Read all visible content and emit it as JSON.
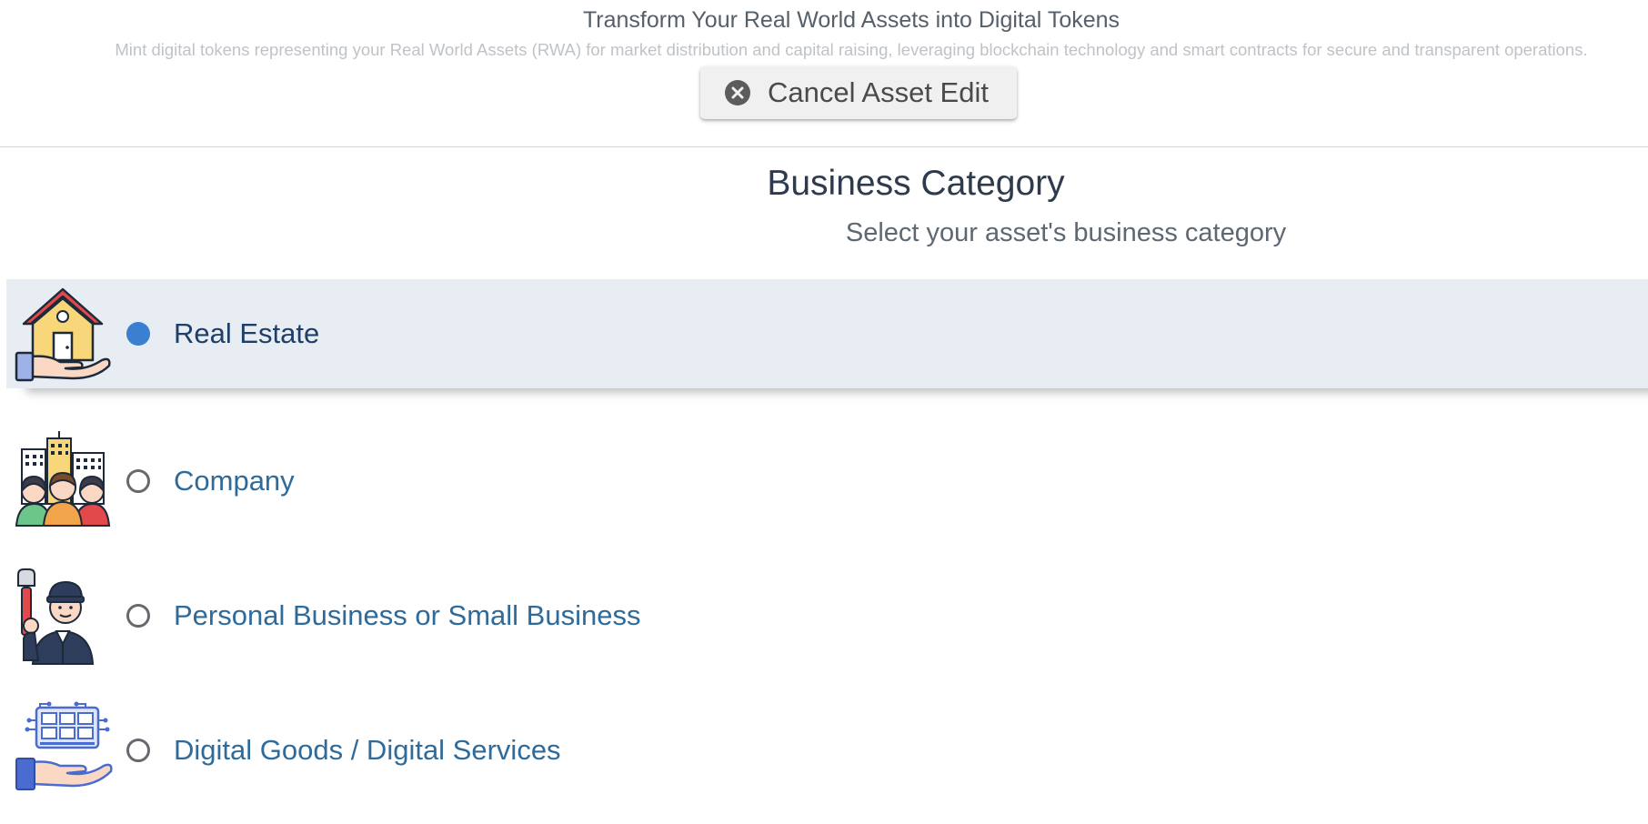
{
  "header": {
    "title": "Transform Your Real World Assets into Digital Tokens",
    "subtitle": "Mint digital tokens representing your Real World Assets (RWA) for market distribution and capital raising, leveraging blockchain technology and smart contracts for secure and transparent operations.",
    "cancel_button": {
      "label": "Cancel Asset Edit",
      "icon": "close-circle-icon"
    }
  },
  "section": {
    "title": "Business Category",
    "subtitle": "Select your asset's business category"
  },
  "categories": [
    {
      "label": "Real Estate",
      "icon": "house-in-hand-icon",
      "selected": true
    },
    {
      "label": "Company",
      "icon": "company-team-icon",
      "selected": false
    },
    {
      "label": "Personal Business or Small Business",
      "icon": "plumber-worker-icon",
      "selected": false
    },
    {
      "label": "Digital Goods / Digital Services",
      "icon": "digital-device-in-hand-icon",
      "selected": false
    }
  ],
  "colors": {
    "selected_row_bg": "#e7edf2",
    "radio_selected": "#3a7fd0",
    "label_color": "#2f6b9a",
    "selected_label_color": "#1f3f66"
  }
}
